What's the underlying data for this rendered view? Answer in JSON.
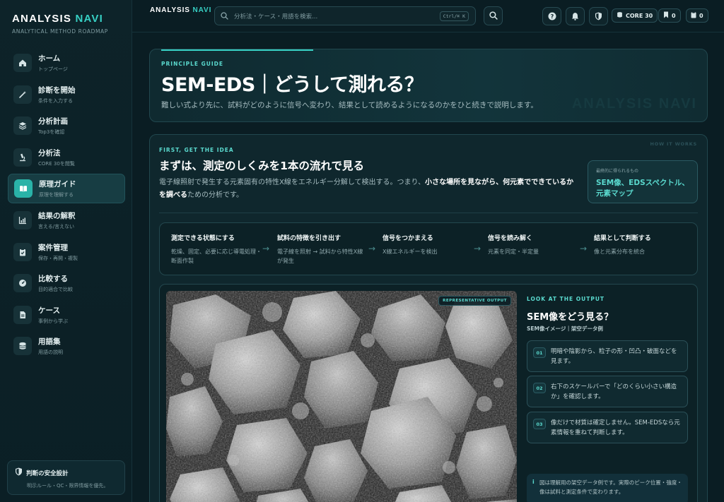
{
  "brand": {
    "name_main": "ANALYSIS",
    "name_accent": "NAVI",
    "subtitle": "ANALYTICAL METHOD ROADMAP"
  },
  "sidebar": {
    "items": [
      {
        "label": "ホーム",
        "sub": "トップページ",
        "icon": "home-icon"
      },
      {
        "label": "診断を開始",
        "sub": "条件を入力する",
        "icon": "wand-icon"
      },
      {
        "label": "分析計画",
        "sub": "Top3を確認",
        "icon": "layers-icon"
      },
      {
        "label": "分析法",
        "sub": "CORE 30を閲覧",
        "icon": "microscope-icon"
      },
      {
        "label": "原理ガイド",
        "sub": "原理を理解する",
        "icon": "book-icon",
        "active": true
      },
      {
        "label": "結果の解釈",
        "sub": "言える/言えない",
        "icon": "chart-icon"
      },
      {
        "label": "案件管理",
        "sub": "保存・再開・複製",
        "icon": "clipboard-icon"
      },
      {
        "label": "比較する",
        "sub": "目的適合で比較",
        "icon": "gauge-icon"
      },
      {
        "label": "ケース",
        "sub": "事例から学ぶ",
        "icon": "document-icon"
      },
      {
        "label": "用語集",
        "sub": "用語の説明",
        "icon": "database-icon"
      }
    ],
    "safety": {
      "title": "判断の安全設計",
      "sub": "明示ルール・QC・限界情報を優先。"
    }
  },
  "topbar": {
    "brand_main": "ANALYSIS",
    "brand_accent": "NAVI",
    "search_placeholder": "分析法・ケース・用語を検索...",
    "shortcut": "Ctrl/⌘ K",
    "core_label": "CORE 30",
    "bookmark_count": "0",
    "clipboard_count": "0"
  },
  "hero": {
    "eyebrow": "PRINCIPLE GUIDE",
    "title": "SEM-EDS｜どうして測れる？",
    "description": "難しい式より先に、試料がどのように信号へ変わり、結果として読めるようになるのかをひと続きで説明します。",
    "watermark": "ANALYSIS NAVI"
  },
  "main": {
    "tag": "HOW IT WORKS",
    "eyebrow": "FIRST, GET THE IDEA",
    "title": "まずは、測定のしくみを1本の流れで見る",
    "desc_1": "電子線照射で発生する元素固有の特性X線をエネルギー分解して検出する。つまり、",
    "desc_bold": "小さな場所を見ながら、何元素でできているかを調べる",
    "desc_2": "ための分析です。",
    "callout_label": "最終的に得られるもの",
    "callout_value": "SEM像、EDSスペクトル、元素マップ",
    "steps": [
      {
        "title": "測定できる状態にする",
        "desc": "乾燥、固定、必要に応じ導電処理・断面作製"
      },
      {
        "title": "試料の特徴を引き出す",
        "desc": "電子線を照射 → 試料から特性X線が発生"
      },
      {
        "title": "信号をつかまえる",
        "desc": "X線エネルギーを検出"
      },
      {
        "title": "信号を読み解く",
        "desc": "元素を同定・半定量"
      },
      {
        "title": "結果として判断する",
        "desc": "像と元素分布を統合"
      }
    ]
  },
  "output": {
    "badge": "REPRESENTATIVE OUTPUT",
    "eyebrow": "LOOK AT THE OUTPUT",
    "title": "SEM像をどう見る？",
    "subtitle": "SEM像イメージ｜架空データ例",
    "points": [
      {
        "num": "01",
        "text": "明暗や陰影から、粒子の形・凹凸・破面などを見ます。"
      },
      {
        "num": "02",
        "text": "右下のスケールバーで「どのくらい小さい構造か」を確認します。"
      },
      {
        "num": "03",
        "text": "像だけで材質は確定しません。SEM-EDSなら元素情報を重ねて判断します。"
      }
    ],
    "note": "図は理解用の架空データ例です。実際のピーク位置・強度・像は試料と測定条件で変わります。"
  },
  "colors": {
    "accent": "#37d0c4",
    "background": "#0a1d23",
    "panel": "#0f272d"
  }
}
